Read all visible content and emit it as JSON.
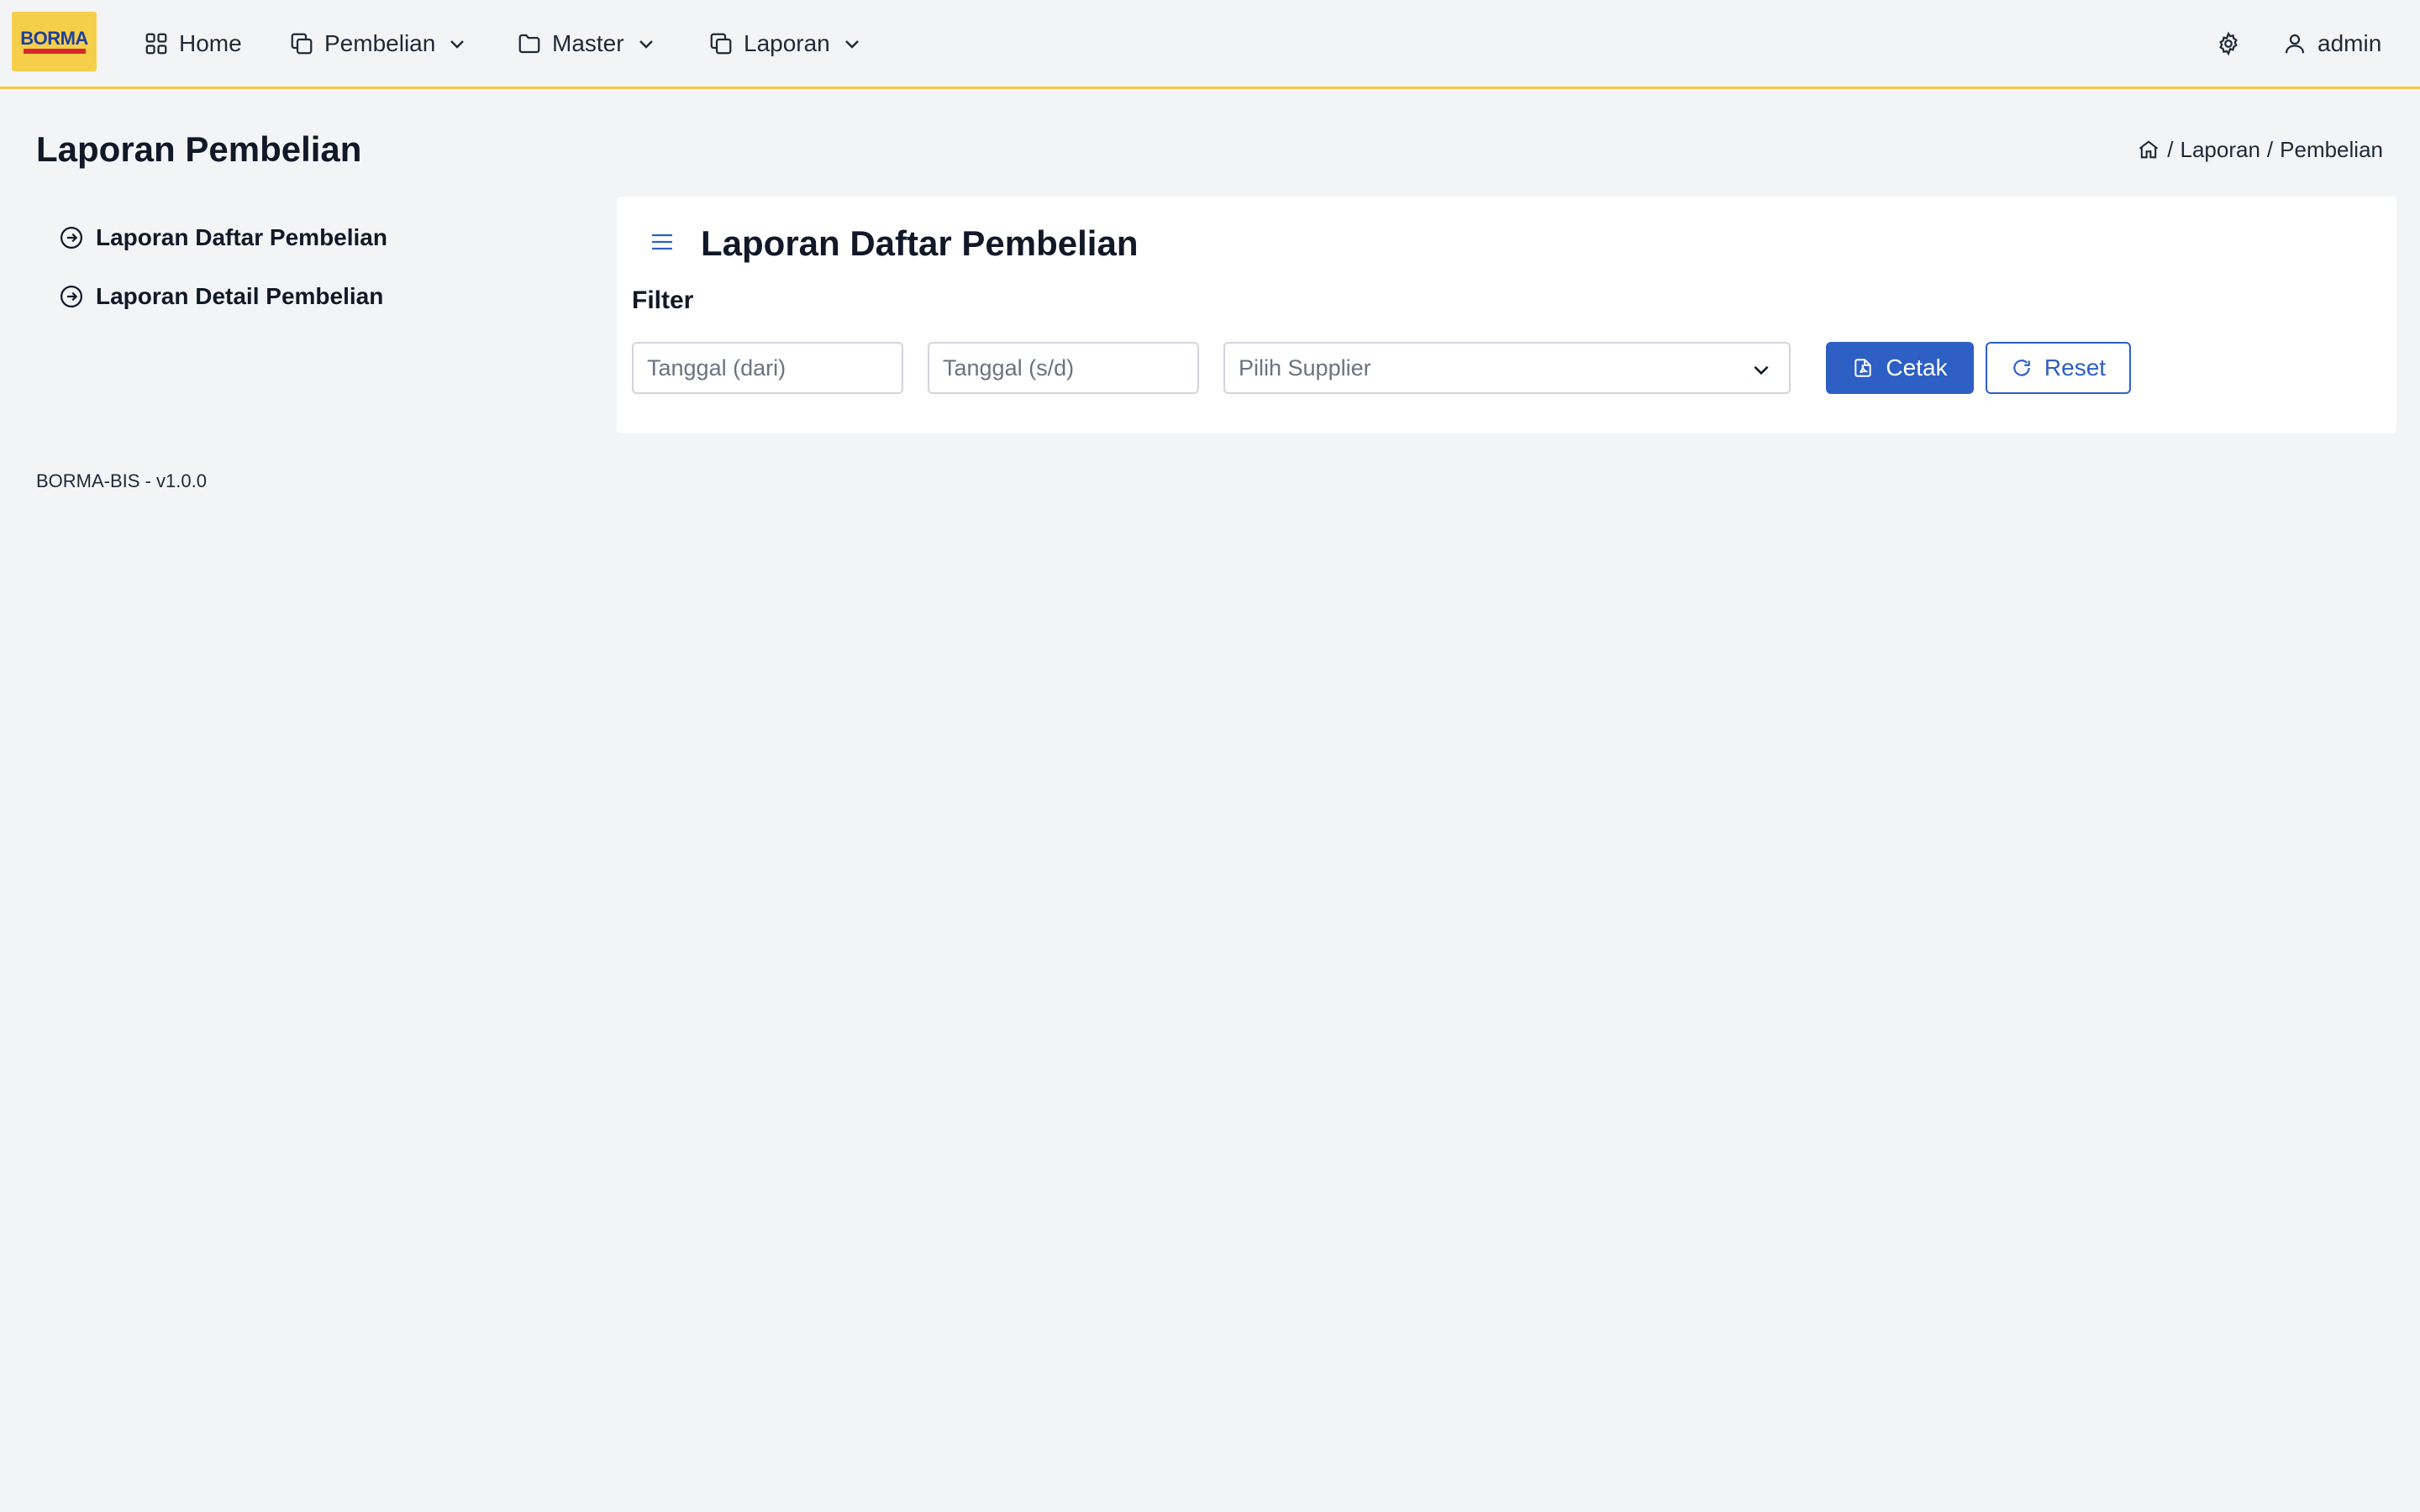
{
  "brand": {
    "logo_text": "BORMA",
    "colors": {
      "logo_bg": "#f6cf4a",
      "logo_text": "#1d3f9e",
      "logo_stripe": "#d8262b",
      "accent": "#f5c842",
      "primary": "#2d5fc4"
    }
  },
  "navbar": {
    "items": [
      {
        "label": "Home",
        "icon": "grid-icon",
        "has_dropdown": false
      },
      {
        "label": "Pembelian",
        "icon": "copy-icon",
        "has_dropdown": true
      },
      {
        "label": "Master",
        "icon": "folder-icon",
        "has_dropdown": true
      },
      {
        "label": "Laporan",
        "icon": "copy-icon",
        "has_dropdown": true
      }
    ],
    "settings_icon": "gear-icon",
    "user": {
      "icon": "user-icon",
      "name": "admin"
    }
  },
  "page": {
    "title": "Laporan Pembelian",
    "breadcrumb": {
      "home_icon": "home-icon",
      "separator": "/",
      "items": [
        "Laporan",
        "Pembelian"
      ]
    }
  },
  "sidebar": {
    "items": [
      {
        "label": "Laporan Daftar Pembelian",
        "icon": "arrow-right-circle-icon"
      },
      {
        "label": "Laporan Detail Pembelian",
        "icon": "arrow-right-circle-icon"
      }
    ]
  },
  "card": {
    "menu_icon": "hamburger-icon",
    "title": "Laporan Daftar Pembelian",
    "filter": {
      "label": "Filter",
      "date_from": {
        "value": "",
        "placeholder": "Tanggal (dari)"
      },
      "date_to": {
        "value": "",
        "placeholder": "Tanggal (s/d)"
      },
      "supplier": {
        "selected": "",
        "placeholder": "Pilih Supplier"
      },
      "print_button": {
        "label": "Cetak",
        "icon": "file-pdf-icon"
      },
      "reset_button": {
        "label": "Reset",
        "icon": "refresh-icon"
      }
    }
  },
  "footer": {
    "text": "BORMA-BIS - v1.0.0"
  }
}
